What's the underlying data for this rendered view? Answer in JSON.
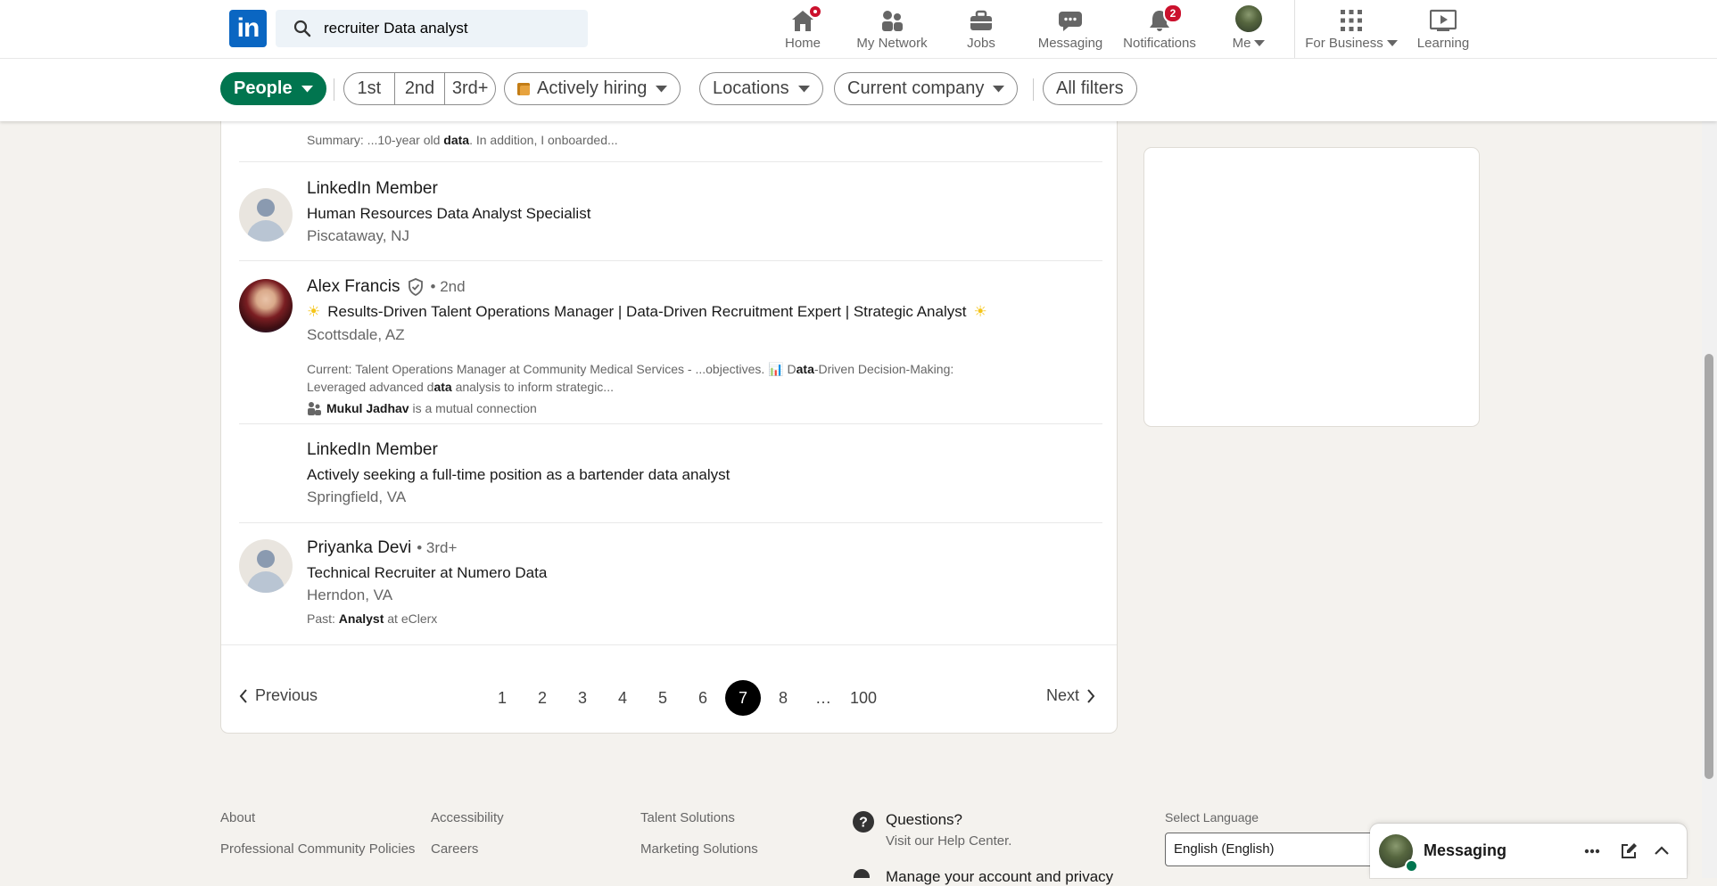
{
  "search": {
    "value": "recruiter Data analyst"
  },
  "nav": {
    "home": "Home",
    "network": "My Network",
    "jobs": "Jobs",
    "messaging": "Messaging",
    "notifications": "Notifications",
    "notifications_count": "2",
    "me": "Me",
    "business": "For Business",
    "learning": "Learning"
  },
  "filters": {
    "people": "People",
    "conn_1": "1st",
    "conn_2": "2nd",
    "conn_3": "3rd+",
    "hiring": "Actively hiring",
    "locations": "Locations",
    "company": "Current company",
    "all": "All filters"
  },
  "results": {
    "partial_summary_prefix": "Summary: ...10-year old ",
    "partial_summary_bold": "data",
    "partial_summary_suffix": ". In addition, I onboarded...",
    "items": [
      {
        "name": "LinkedIn Member",
        "headline": "Human Resources Data Analyst Specialist",
        "location": "Piscataway, NJ"
      },
      {
        "name": "Alex Francis",
        "degree": "• 2nd",
        "headline": "Results-Driven Talent Operations Manager | Data-Driven Recruitment Expert | Strategic Analyst",
        "location": "Scottsdale, AZ",
        "current_1a": "Current: Talent Operations Manager at Community Medical Services - ...objectives. 📊 D",
        "current_1b": "ata",
        "current_1c": "-Driven Decision-Making:",
        "current_2a": "Leveraged advanced d",
        "current_2b": "ata",
        "current_2c": " analysis to inform strategic...",
        "mutual_name": "Mukul Jadhav",
        "mutual_text": " is a mutual connection"
      },
      {
        "name": "LinkedIn Member",
        "headline": "Actively seeking a full-time position as a bartender data analyst",
        "location": "Springfield, VA"
      },
      {
        "name": "Priyanka Devi",
        "degree": "• 3rd+",
        "headline": "Technical Recruiter at Numero Data",
        "location": "Herndon, VA",
        "past_prefix": "Past: ",
        "past_bold": "Analyst",
        "past_suffix": " at eClerx"
      }
    ]
  },
  "pagination": {
    "previous": "Previous",
    "next": "Next",
    "pages": [
      "1",
      "2",
      "3",
      "4",
      "5",
      "6",
      "7",
      "8",
      "…",
      "100"
    ],
    "current": "7"
  },
  "footer": {
    "about": "About",
    "policies": "Professional Community Policies",
    "accessibility": "Accessibility",
    "careers": "Careers",
    "talent": "Talent Solutions",
    "marketing": "Marketing Solutions",
    "questions": "Questions?",
    "help": "Visit our Help Center.",
    "manage": "Manage your account and privacy",
    "lang_label": "Select Language",
    "lang_value": "English (English)"
  },
  "messaging_dock": {
    "title": "Messaging"
  },
  "colors": {
    "brand": "#0a66c2",
    "accent_green": "#01754f",
    "badge": "#cb112d"
  }
}
